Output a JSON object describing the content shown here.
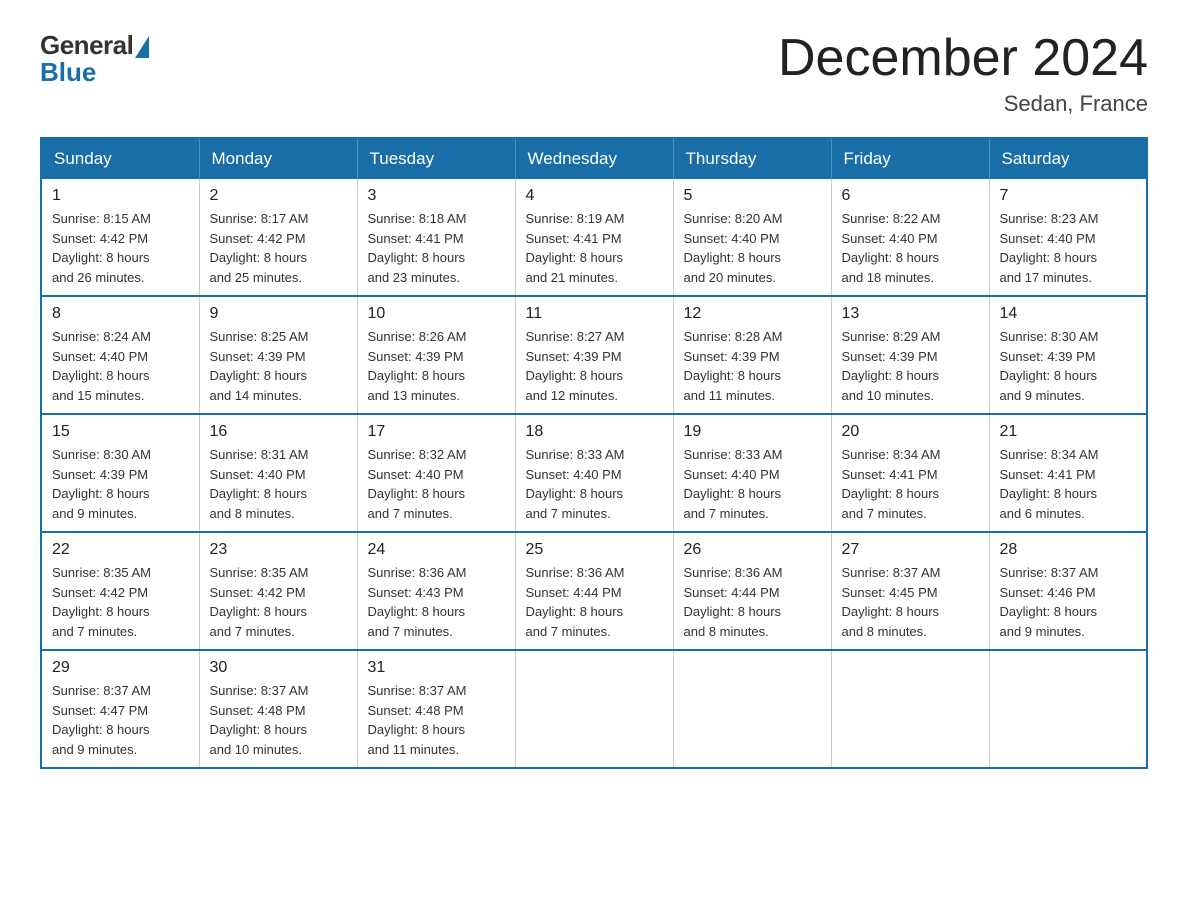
{
  "logo": {
    "general": "General",
    "blue": "Blue"
  },
  "title": "December 2024",
  "location": "Sedan, France",
  "days_of_week": [
    "Sunday",
    "Monday",
    "Tuesday",
    "Wednesday",
    "Thursday",
    "Friday",
    "Saturday"
  ],
  "weeks": [
    [
      {
        "day": "1",
        "sunrise": "8:15 AM",
        "sunset": "4:42 PM",
        "daylight": "8 hours and 26 minutes."
      },
      {
        "day": "2",
        "sunrise": "8:17 AM",
        "sunset": "4:42 PM",
        "daylight": "8 hours and 25 minutes."
      },
      {
        "day": "3",
        "sunrise": "8:18 AM",
        "sunset": "4:41 PM",
        "daylight": "8 hours and 23 minutes."
      },
      {
        "day": "4",
        "sunrise": "8:19 AM",
        "sunset": "4:41 PM",
        "daylight": "8 hours and 21 minutes."
      },
      {
        "day": "5",
        "sunrise": "8:20 AM",
        "sunset": "4:40 PM",
        "daylight": "8 hours and 20 minutes."
      },
      {
        "day": "6",
        "sunrise": "8:22 AM",
        "sunset": "4:40 PM",
        "daylight": "8 hours and 18 minutes."
      },
      {
        "day": "7",
        "sunrise": "8:23 AM",
        "sunset": "4:40 PM",
        "daylight": "8 hours and 17 minutes."
      }
    ],
    [
      {
        "day": "8",
        "sunrise": "8:24 AM",
        "sunset": "4:40 PM",
        "daylight": "8 hours and 15 minutes."
      },
      {
        "day": "9",
        "sunrise": "8:25 AM",
        "sunset": "4:39 PM",
        "daylight": "8 hours and 14 minutes."
      },
      {
        "day": "10",
        "sunrise": "8:26 AM",
        "sunset": "4:39 PM",
        "daylight": "8 hours and 13 minutes."
      },
      {
        "day": "11",
        "sunrise": "8:27 AM",
        "sunset": "4:39 PM",
        "daylight": "8 hours and 12 minutes."
      },
      {
        "day": "12",
        "sunrise": "8:28 AM",
        "sunset": "4:39 PM",
        "daylight": "8 hours and 11 minutes."
      },
      {
        "day": "13",
        "sunrise": "8:29 AM",
        "sunset": "4:39 PM",
        "daylight": "8 hours and 10 minutes."
      },
      {
        "day": "14",
        "sunrise": "8:30 AM",
        "sunset": "4:39 PM",
        "daylight": "8 hours and 9 minutes."
      }
    ],
    [
      {
        "day": "15",
        "sunrise": "8:30 AM",
        "sunset": "4:39 PM",
        "daylight": "8 hours and 9 minutes."
      },
      {
        "day": "16",
        "sunrise": "8:31 AM",
        "sunset": "4:40 PM",
        "daylight": "8 hours and 8 minutes."
      },
      {
        "day": "17",
        "sunrise": "8:32 AM",
        "sunset": "4:40 PM",
        "daylight": "8 hours and 7 minutes."
      },
      {
        "day": "18",
        "sunrise": "8:33 AM",
        "sunset": "4:40 PM",
        "daylight": "8 hours and 7 minutes."
      },
      {
        "day": "19",
        "sunrise": "8:33 AM",
        "sunset": "4:40 PM",
        "daylight": "8 hours and 7 minutes."
      },
      {
        "day": "20",
        "sunrise": "8:34 AM",
        "sunset": "4:41 PM",
        "daylight": "8 hours and 7 minutes."
      },
      {
        "day": "21",
        "sunrise": "8:34 AM",
        "sunset": "4:41 PM",
        "daylight": "8 hours and 6 minutes."
      }
    ],
    [
      {
        "day": "22",
        "sunrise": "8:35 AM",
        "sunset": "4:42 PM",
        "daylight": "8 hours and 7 minutes."
      },
      {
        "day": "23",
        "sunrise": "8:35 AM",
        "sunset": "4:42 PM",
        "daylight": "8 hours and 7 minutes."
      },
      {
        "day": "24",
        "sunrise": "8:36 AM",
        "sunset": "4:43 PM",
        "daylight": "8 hours and 7 minutes."
      },
      {
        "day": "25",
        "sunrise": "8:36 AM",
        "sunset": "4:44 PM",
        "daylight": "8 hours and 7 minutes."
      },
      {
        "day": "26",
        "sunrise": "8:36 AM",
        "sunset": "4:44 PM",
        "daylight": "8 hours and 8 minutes."
      },
      {
        "day": "27",
        "sunrise": "8:37 AM",
        "sunset": "4:45 PM",
        "daylight": "8 hours and 8 minutes."
      },
      {
        "day": "28",
        "sunrise": "8:37 AM",
        "sunset": "4:46 PM",
        "daylight": "8 hours and 9 minutes."
      }
    ],
    [
      {
        "day": "29",
        "sunrise": "8:37 AM",
        "sunset": "4:47 PM",
        "daylight": "8 hours and 9 minutes."
      },
      {
        "day": "30",
        "sunrise": "8:37 AM",
        "sunset": "4:48 PM",
        "daylight": "8 hours and 10 minutes."
      },
      {
        "day": "31",
        "sunrise": "8:37 AM",
        "sunset": "4:48 PM",
        "daylight": "8 hours and 11 minutes."
      },
      null,
      null,
      null,
      null
    ]
  ],
  "labels": {
    "sunrise": "Sunrise:",
    "sunset": "Sunset:",
    "daylight": "Daylight:"
  }
}
